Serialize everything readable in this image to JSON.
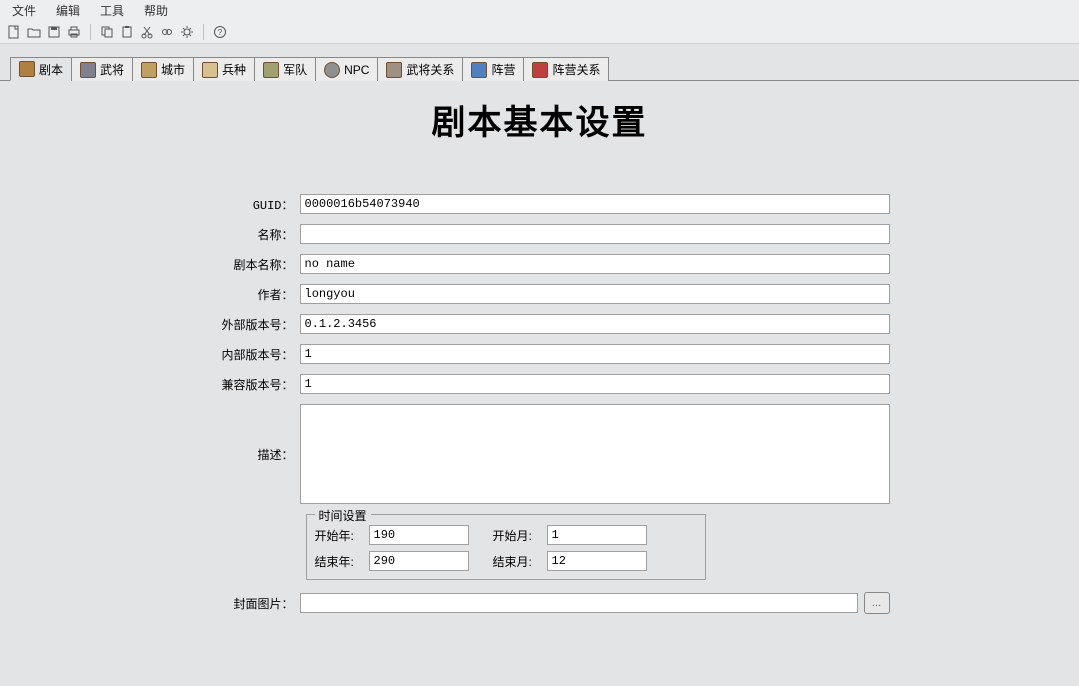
{
  "menu": {
    "file": "文件",
    "edit": "编辑",
    "tools": "工具",
    "help": "帮助"
  },
  "tabs": [
    {
      "label": "剧本"
    },
    {
      "label": "武将"
    },
    {
      "label": "城市"
    },
    {
      "label": "兵种"
    },
    {
      "label": "军队"
    },
    {
      "label": "NPC"
    },
    {
      "label": "武将关系"
    },
    {
      "label": "阵营"
    },
    {
      "label": "阵营关系"
    }
  ],
  "page_title": "剧本基本设置",
  "labels": {
    "guid": "GUID：",
    "name": "名称：",
    "script_name": "剧本名称：",
    "author": "作者：",
    "ext_version": "外部版本号：",
    "int_version": "内部版本号：",
    "compat_version": "兼容版本号：",
    "description": "描述：",
    "cover": "封面图片："
  },
  "values": {
    "guid": "0000016b54073940",
    "name": "",
    "script_name": "no name",
    "author": "longyou",
    "ext_version": "0.1.2.3456",
    "int_version": "1",
    "compat_version": "1",
    "description": "",
    "cover": ""
  },
  "time": {
    "legend": "时间设置",
    "start_year_label": "开始年:",
    "start_year": "190",
    "start_month_label": "开始月:",
    "start_month": "1",
    "end_year_label": "结束年:",
    "end_year": "290",
    "end_month_label": "结束月:",
    "end_month": "12"
  },
  "browse_glyph": "…"
}
